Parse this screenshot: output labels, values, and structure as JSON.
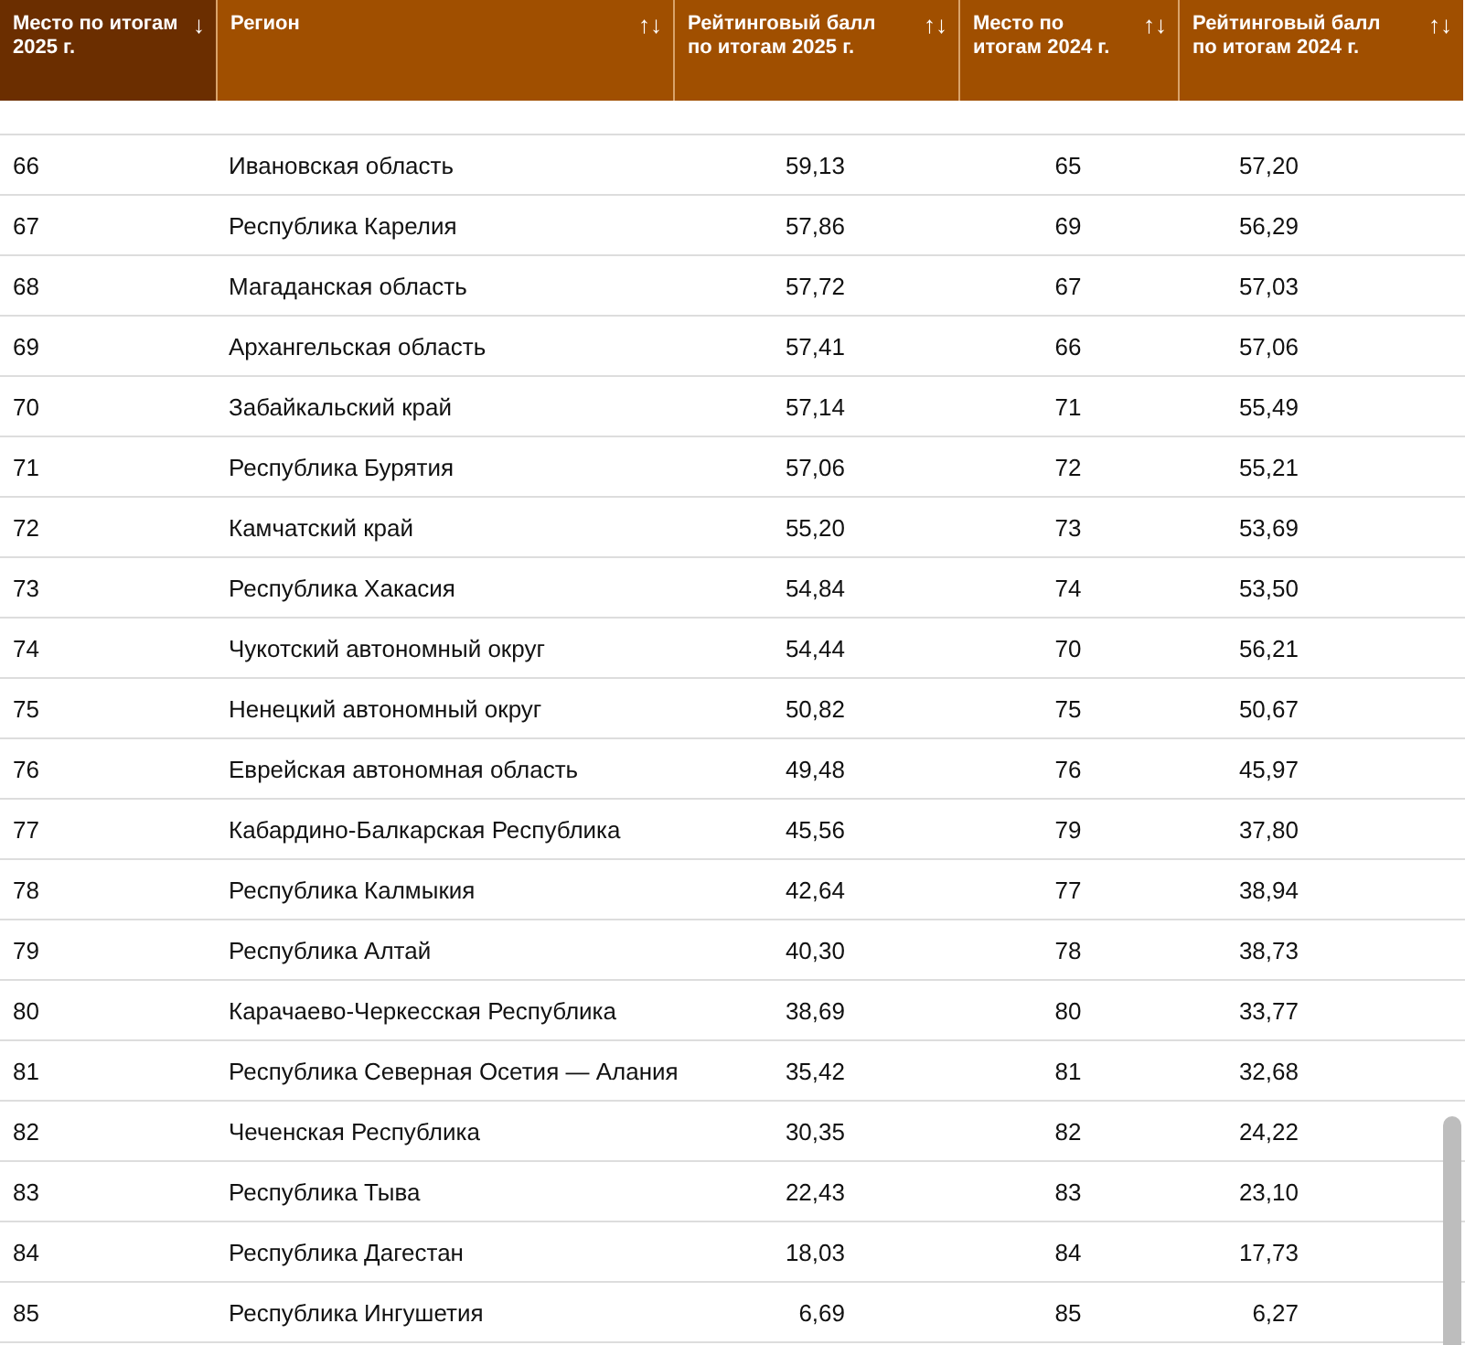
{
  "table": {
    "columns": [
      {
        "label": "Место по итогам 2025 г.",
        "sort_icon": "↓",
        "selected": true
      },
      {
        "label": "Регион",
        "sort_icon": "↑↓",
        "selected": false
      },
      {
        "label": "Рейтинговый балл по итогам 2025 г.",
        "sort_icon": "↑↓",
        "selected": false
      },
      {
        "label": "Место по итогам 2024 г.",
        "sort_icon": "↑↓",
        "selected": false
      },
      {
        "label": "Рейтинговый балл по итогам 2024 г.",
        "sort_icon": "↑↓",
        "selected": false
      }
    ],
    "rows": [
      [
        "66",
        "Ивановская область",
        "59,13",
        "65",
        "57,20"
      ],
      [
        "67",
        "Республика Карелия",
        "57,86",
        "69",
        "56,29"
      ],
      [
        "68",
        "Магаданская область",
        "57,72",
        "67",
        "57,03"
      ],
      [
        "69",
        "Архангельская область",
        "57,41",
        "66",
        "57,06"
      ],
      [
        "70",
        "Забайкальский край",
        "57,14",
        "71",
        "55,49"
      ],
      [
        "71",
        "Республика Бурятия",
        "57,06",
        "72",
        "55,21"
      ],
      [
        "72",
        "Камчатский край",
        "55,20",
        "73",
        "53,69"
      ],
      [
        "73",
        "Республика Хакасия",
        "54,84",
        "74",
        "53,50"
      ],
      [
        "74",
        "Чукотский автономный округ",
        "54,44",
        "70",
        "56,21"
      ],
      [
        "75",
        "Ненецкий автономный округ",
        "50,82",
        "75",
        "50,67"
      ],
      [
        "76",
        "Еврейская автономная область",
        "49,48",
        "76",
        "45,97"
      ],
      [
        "77",
        "Кабардино-Балкарская Республика",
        "45,56",
        "79",
        "37,80"
      ],
      [
        "78",
        "Республика Калмыкия",
        "42,64",
        "77",
        "38,94"
      ],
      [
        "79",
        "Республика Алтай",
        "40,30",
        "78",
        "38,73"
      ],
      [
        "80",
        "Карачаево-Черкесская Республика",
        "38,69",
        "80",
        "33,77"
      ],
      [
        "81",
        "Республика Северная Осетия — Алания",
        "35,42",
        "81",
        "32,68"
      ],
      [
        "82",
        "Чеченская Республика",
        "30,35",
        "82",
        "24,22"
      ],
      [
        "83",
        "Республика Тыва",
        "22,43",
        "83",
        "23,10"
      ],
      [
        "84",
        "Республика Дагестан",
        "18,03",
        "84",
        "17,73"
      ],
      [
        "85",
        "Республика Ингушетия",
        "6,69",
        "85",
        "6,27"
      ]
    ]
  }
}
